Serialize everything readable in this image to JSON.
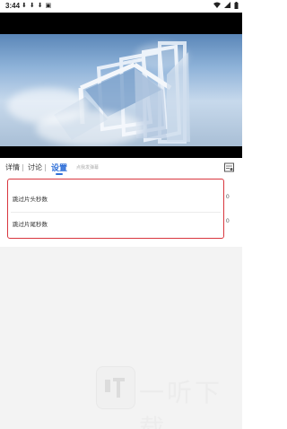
{
  "status_bar": {
    "time": "3:44",
    "icons": [
      "download-icon",
      "download-icon",
      "download-icon",
      "image-icon"
    ]
  },
  "tabs": [
    {
      "label": "详情",
      "active": false
    },
    {
      "label": "讨论",
      "active": false
    },
    {
      "label": "设置",
      "active": true
    }
  ],
  "tab_hint": "点我发弹幕",
  "settings": {
    "rows": [
      {
        "label": "跳过片头秒数",
        "value": "0"
      },
      {
        "label": "跳过片尾秒数",
        "value": "0"
      }
    ],
    "highlight_color": "#d9363e"
  },
  "colors": {
    "accent": "#2f6fd8",
    "background_lower": "#f3f3f3"
  },
  "watermark": {
    "text": "一听下载"
  }
}
